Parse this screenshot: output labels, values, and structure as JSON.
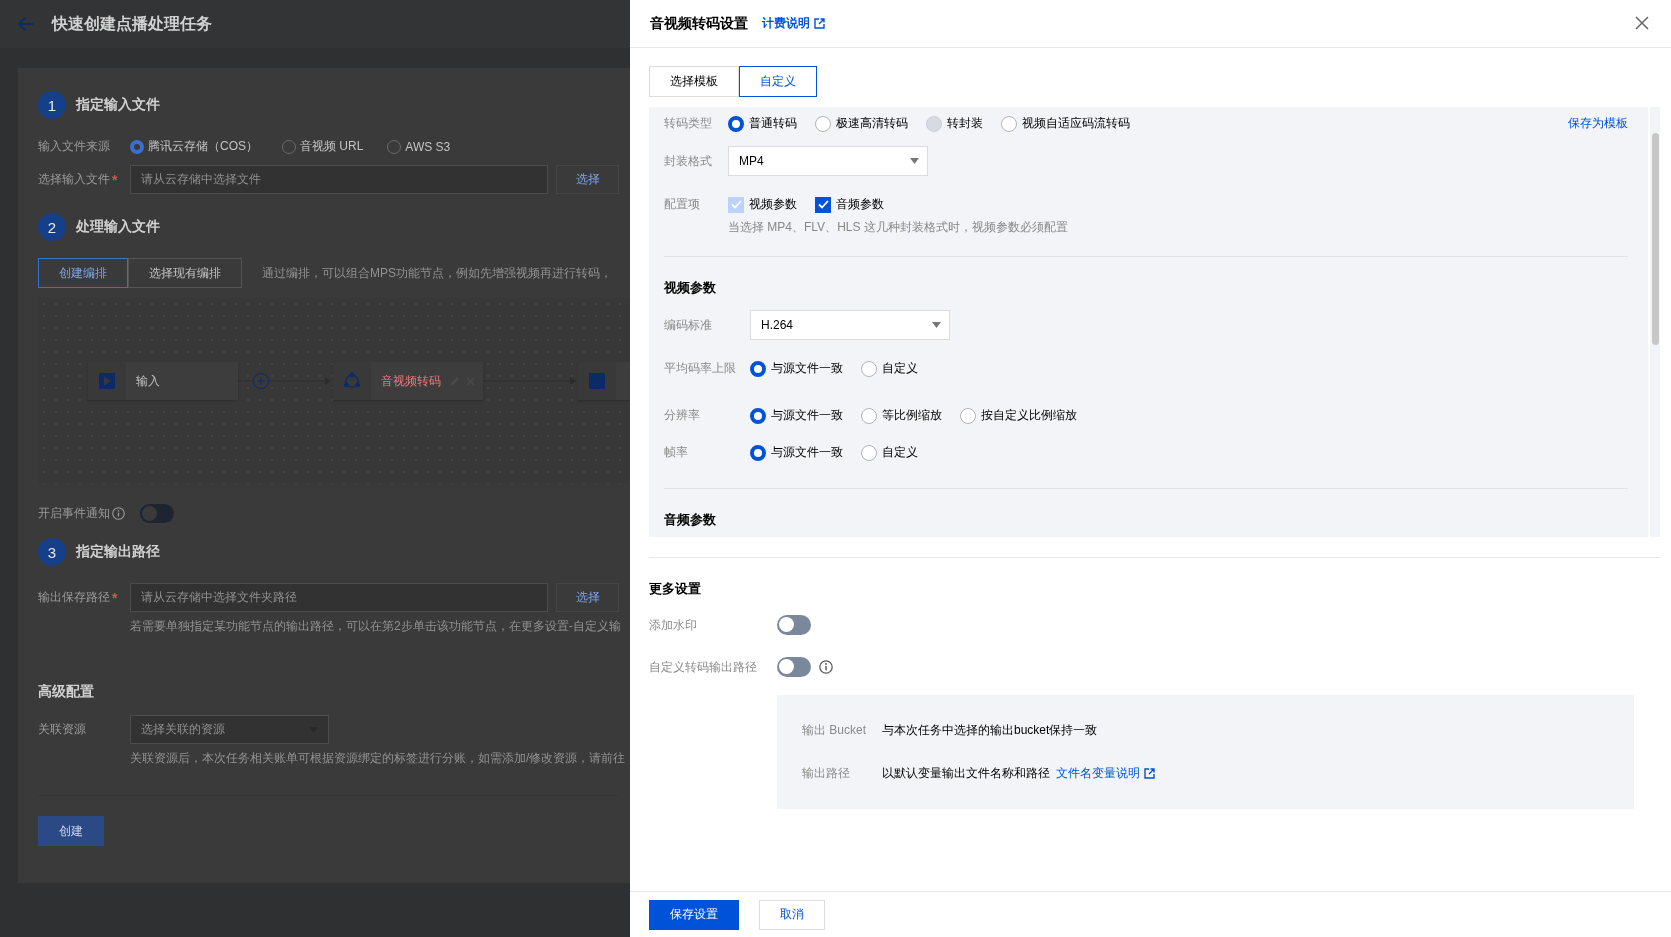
{
  "page": {
    "title": "快速创建点播处理任务",
    "step1": {
      "number": "1",
      "title": "指定输入文件",
      "source_label": "输入文件来源",
      "sources": [
        {
          "label": "腾讯云存储（COS）",
          "selected": true
        },
        {
          "label": "音视频 URL",
          "selected": false
        },
        {
          "label": "AWS S3",
          "selected": false
        }
      ],
      "file_label": "选择输入文件",
      "required_mark": "*",
      "file_placeholder": "请从云存储中选择文件",
      "choose_button": "选择"
    },
    "step2": {
      "number": "2",
      "title": "处理输入文件",
      "tabs": [
        {
          "label": "创建编排",
          "selected": true
        },
        {
          "label": "选择现有编排",
          "selected": false
        }
      ],
      "hint": "通过编排，可以组合MPS功能节点，例如先增强视频再进行转码，",
      "nodes": [
        {
          "kind": "input",
          "label": "输入"
        },
        {
          "kind": "transcode",
          "label": "音视频转码"
        }
      ],
      "event_notify": {
        "label": "开启事件通知",
        "on": false
      }
    },
    "step3": {
      "number": "3",
      "title": "指定输出路径",
      "path_label": "输出保存路径",
      "required_mark": "*",
      "path_placeholder": "请从云存储中选择文件夹路径",
      "choose_button": "选择",
      "hint": "若需要单独指定某功能节点的输出路径，可以在第2步单击该功能节点，在更多设置-自定义输"
    },
    "advanced": {
      "title": "高级配置",
      "resource_label": "关联资源",
      "resource_placeholder": "选择关联的资源",
      "hint": "关联资源后，本次任务相关账单可根据资源绑定的标签进行分账，如需添加/修改资源，请前往"
    },
    "create_button": "创建"
  },
  "drawer": {
    "title": "音视频转码设置",
    "billing_link": "计费说明",
    "tabs": [
      {
        "label": "选择模板",
        "selected": false
      },
      {
        "label": "自定义",
        "selected": true
      }
    ],
    "transcode_type": {
      "label": "转码类型",
      "options": [
        {
          "label": "普通转码",
          "selected": true,
          "disabled": false
        },
        {
          "label": "极速高清转码",
          "selected": false,
          "disabled": false
        },
        {
          "label": "转封装",
          "selected": false,
          "disabled": true
        },
        {
          "label": "视频自适应码流转码",
          "selected": false,
          "disabled": false
        }
      ]
    },
    "save_template": "保存为模板",
    "container": {
      "label": "封装格式",
      "value": "MP4"
    },
    "config": {
      "label": "配置项",
      "options": [
        {
          "label": "视频参数",
          "checked": true,
          "disabled": true
        },
        {
          "label": "音频参数",
          "checked": true,
          "disabled": false
        }
      ],
      "hint": "当选择 MP4、FLV、HLS 这几种封装格式时，视频参数必须配置"
    },
    "video": {
      "title": "视频参数",
      "codec": {
        "label": "编码标准",
        "value": "H.264"
      },
      "rows": [
        {
          "label": "平均码率上限",
          "options": [
            {
              "label": "与源文件一致",
              "selected": true
            },
            {
              "label": "自定义",
              "selected": false
            }
          ]
        },
        {
          "label": "分辨率",
          "options": [
            {
              "label": "与源文件一致",
              "selected": true
            },
            {
              "label": "等比例缩放",
              "selected": false
            },
            {
              "label": "按自定义比例缩放",
              "selected": false
            }
          ]
        },
        {
          "label": "帧率",
          "options": [
            {
              "label": "与源文件一致",
              "selected": true
            },
            {
              "label": "自定义",
              "selected": false
            }
          ]
        }
      ]
    },
    "audio": {
      "title": "音频参数"
    },
    "more": {
      "title": "更多设置",
      "toggles": [
        {
          "label": "添加水印",
          "on": false,
          "info": false
        },
        {
          "label": "自定义转码输出路径",
          "on": false,
          "info": true
        }
      ],
      "output": [
        {
          "label": "输出 Bucket",
          "value": "与本次任务中选择的输出bucket保持一致"
        },
        {
          "label": "输出路径",
          "value": "以默认变量输出文件名称和路径",
          "link": "文件名变量说明"
        }
      ]
    },
    "footer": {
      "save": "保存设置",
      "cancel": "取消"
    }
  }
}
